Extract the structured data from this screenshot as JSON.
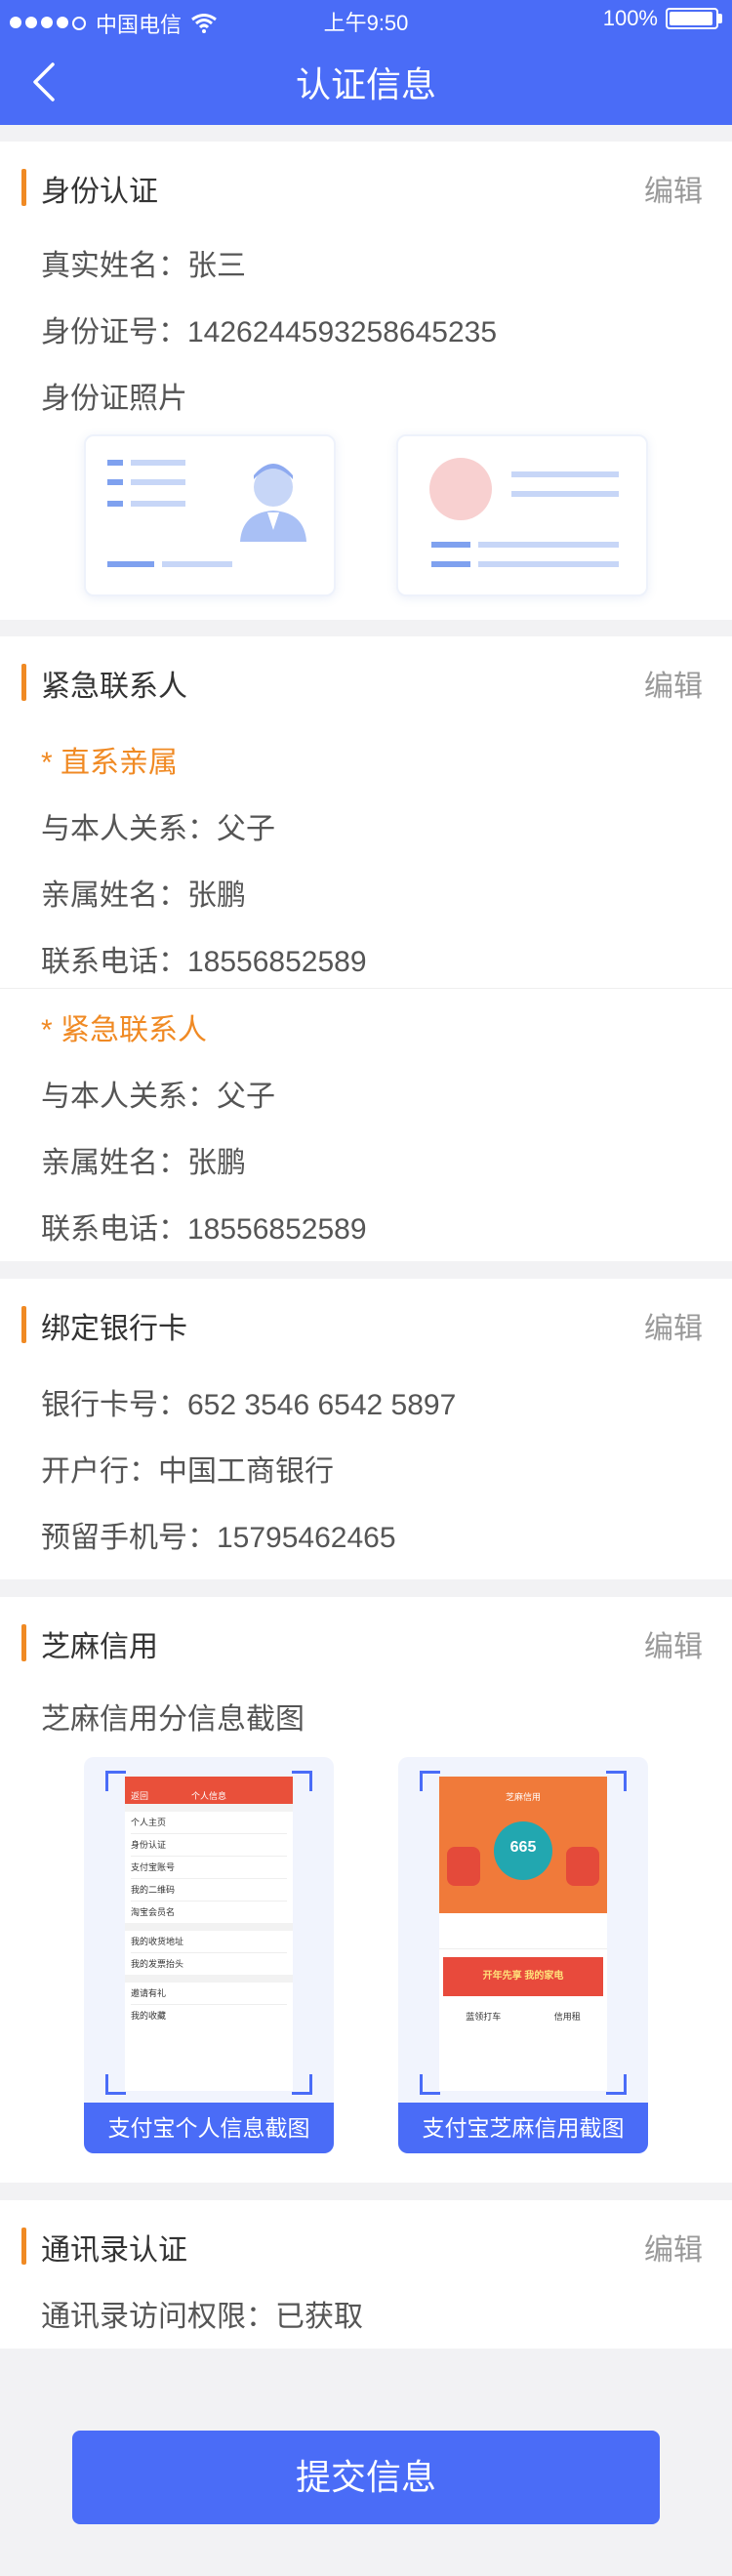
{
  "status_bar": {
    "carrier": "中国电信",
    "time": "上午9:50",
    "battery": "100%"
  },
  "header": {
    "title": "认证信息"
  },
  "identity": {
    "title": "身份认证",
    "edit": "编辑",
    "real_name": "真实姓名：张三",
    "id_number": "身份证号：1426244593258645235",
    "id_photo_label": "身份证照片"
  },
  "emergency": {
    "title": "紧急联系人",
    "edit": "编辑",
    "direct_title": "* 直系亲属",
    "direct_relation": "与本人关系：父子",
    "direct_name": "亲属姓名：张鹏",
    "direct_phone": "联系电话：18556852589",
    "urgent_title": "* 紧急联系人",
    "urgent_relation": "与本人关系：父子",
    "urgent_name": "亲属姓名：张鹏",
    "urgent_phone": "联系电话：18556852589"
  },
  "bank": {
    "title": "绑定银行卡",
    "edit": "编辑",
    "card_number": "银行卡号：652 3546 6542 5897",
    "bank_name": "开户行：中国工商银行",
    "phone": "预留手机号：15795462465"
  },
  "sesame": {
    "title": "芝麻信用",
    "edit": "编辑",
    "label": "芝麻信用分信息截图",
    "shot1_caption": "支付宝个人信息截图",
    "shot2_caption": "支付宝芝麻信用截图",
    "shot1": {
      "title": "个人信息",
      "back": "返回",
      "rows": [
        "个人主页",
        "身份认证",
        "支付宝账号",
        "我的二维码",
        "淘宝会员名",
        "我的收货地址",
        "我的发票抬头",
        "邀请有礼",
        "我的收藏"
      ]
    },
    "shot2": {
      "title": "芝麻信用",
      "score": "665",
      "banner": "开年先享 我的家电",
      "item1": "蓝领打车",
      "item2": "信用租"
    }
  },
  "contacts": {
    "title": "通讯录认证",
    "edit": "编辑",
    "permission": "通讯录访问权限：已获取"
  },
  "submit_label": "提交信息",
  "colors": {
    "primary": "#4a6cf7",
    "accent": "#f08a24"
  }
}
